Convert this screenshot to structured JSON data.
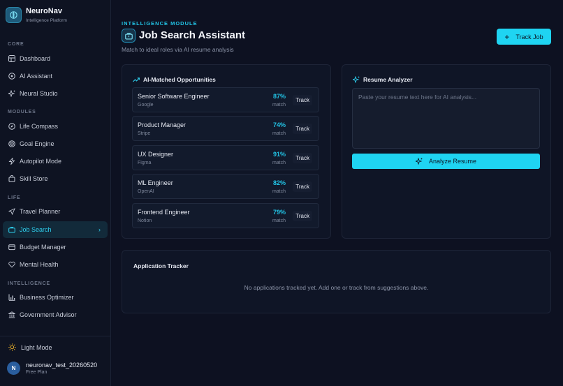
{
  "brand": {
    "name": "NeuroNav",
    "subtitle": "Intelligence Platform"
  },
  "sidebar": {
    "sections": [
      {
        "label": "CORE",
        "items": [
          {
            "label": "Dashboard",
            "icon": "grid-icon"
          },
          {
            "label": "AI Assistant",
            "icon": "ai-icon"
          },
          {
            "label": "Neural Studio",
            "icon": "sparkle-icon"
          }
        ]
      },
      {
        "label": "MODULES",
        "items": [
          {
            "label": "Life Compass",
            "icon": "compass-icon"
          },
          {
            "label": "Goal Engine",
            "icon": "target-icon"
          },
          {
            "label": "Autopilot Mode",
            "icon": "bolt-icon"
          },
          {
            "label": "Skill Store",
            "icon": "store-icon"
          }
        ]
      },
      {
        "label": "LIFE",
        "items": [
          {
            "label": "Travel Planner",
            "icon": "plane-icon"
          },
          {
            "label": "Job Search",
            "icon": "briefcase-icon",
            "active": true
          },
          {
            "label": "Budget Manager",
            "icon": "wallet-icon"
          },
          {
            "label": "Mental Health",
            "icon": "heart-icon"
          }
        ]
      },
      {
        "label": "INTELLIGENCE",
        "items": [
          {
            "label": "Business Optimizer",
            "icon": "bar-chart-icon"
          },
          {
            "label": "Government Advisor",
            "icon": "building-icon"
          }
        ]
      }
    ],
    "light_mode_label": "Light Mode",
    "user": {
      "initial": "N",
      "name": "neuronav_test_20260520",
      "plan": "Free Plan"
    }
  },
  "header": {
    "eyebrow": "INTELLIGENCE MODULE",
    "title": "Job Search Assistant",
    "subtitle": "Match to ideal roles via AI resume analysis",
    "track_job_label": "Track Job"
  },
  "opportunities": {
    "title": "AI-Matched Opportunities",
    "match_label": "match",
    "track_label": "Track",
    "jobs": [
      {
        "title": "Senior Software Engineer",
        "company": "Google",
        "match": "87%"
      },
      {
        "title": "Product Manager",
        "company": "Stripe",
        "match": "74%"
      },
      {
        "title": "UX Designer",
        "company": "Figma",
        "match": "91%"
      },
      {
        "title": "ML Engineer",
        "company": "OpenAI",
        "match": "82%"
      },
      {
        "title": "Frontend Engineer",
        "company": "Notion",
        "match": "79%"
      }
    ]
  },
  "resume": {
    "title": "Resume Analyzer",
    "placeholder": "Paste your resume text here for AI analysis...",
    "analyze_label": "Analyze Resume"
  },
  "tracker": {
    "title": "Application Tracker",
    "empty_message": "No applications tracked yet. Add one or track from suggestions above."
  },
  "colors": {
    "accent": "#1fd4f2",
    "background": "#0d1121",
    "card": "#0f1526"
  }
}
